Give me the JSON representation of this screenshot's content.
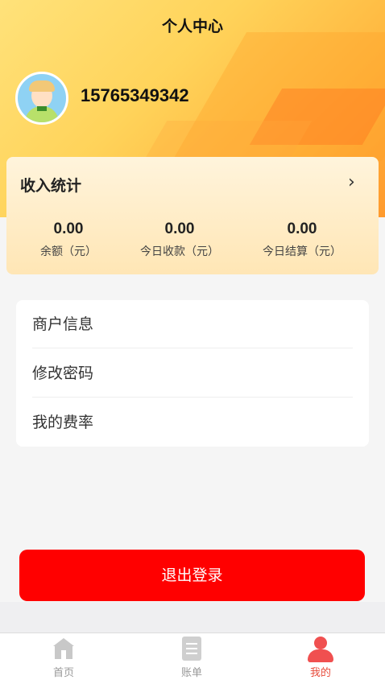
{
  "header": {
    "title": "个人中心",
    "phone": "15765349342"
  },
  "income": {
    "title": "收入统计",
    "chevron": "›",
    "stats": [
      {
        "value": "0.00",
        "label": "余额（元）"
      },
      {
        "value": "0.00",
        "label": "今日收款（元）"
      },
      {
        "value": "0.00",
        "label": "今日结算（元）"
      }
    ]
  },
  "menu": {
    "items": [
      {
        "label": "商户信息"
      },
      {
        "label": "修改密码"
      },
      {
        "label": "我的费率"
      }
    ]
  },
  "logout": {
    "label": "退出登录"
  },
  "tabbar": {
    "tabs": [
      {
        "label": "首页",
        "icon": "home-icon"
      },
      {
        "label": "账单",
        "icon": "bill-icon"
      },
      {
        "label": "我的",
        "icon": "user-icon",
        "active": true
      }
    ]
  },
  "colors": {
    "accent": "#ff0000",
    "active_tab": "#e74c3c",
    "header_gradient_start": "#ffe27a",
    "header_gradient_end": "#ff9a2e"
  }
}
